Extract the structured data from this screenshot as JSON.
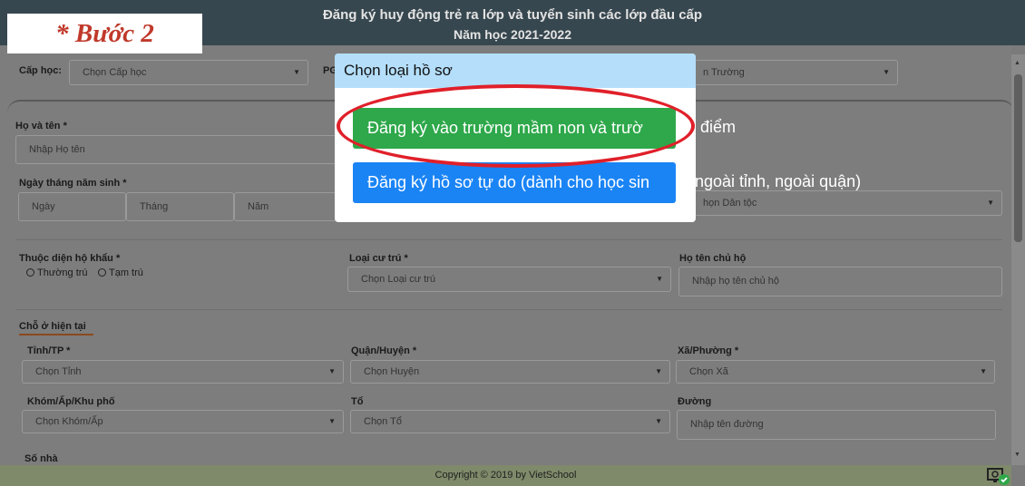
{
  "header": {
    "line1": "Đăng ký huy động trẻ ra lớp và tuyển sinh các lớp đầu cấp",
    "line2": "Năm học 2021-2022",
    "step_tag": "* Bước 2"
  },
  "filters": {
    "cap_hoc_label": "Cấp học:",
    "cap_hoc_value": "Chọn Cấp học",
    "second_label_fragment": "PG",
    "school_value_fragment": "n Trường"
  },
  "form": {
    "ho_ten_label": "Họ và tên *",
    "ho_ten_placeholder": "Nhập Họ tên",
    "dob_label": "Ngày tháng năm sinh *",
    "dob_day": "Ngày",
    "dob_month": "Tháng",
    "dob_year": "Năm",
    "dan_toc_fragment": "họn Dân tộc",
    "ho_khau_label": "Thuộc diện hộ khẩu *",
    "ho_khau_opt1": "Thường trú",
    "ho_khau_opt2": "Tạm trú",
    "loai_cu_tru_label": "Loại cư trú *",
    "loai_cu_tru_value": "Chọn Loại cư trú",
    "chu_ho_label": "Họ tên chủ hộ",
    "chu_ho_placeholder": "Nhập họ tên chủ hộ",
    "current_section": "Chỗ ở hiện tại",
    "tinh_label": "Tỉnh/TP *",
    "tinh_value": "Chọn Tỉnh",
    "huyen_label": "Quận/Huyện *",
    "huyen_value": "Chọn Huyện",
    "xa_label": "Xã/Phường *",
    "xa_value": "Chọn Xã",
    "khom_label": "Khóm/Ấp/Khu phố",
    "khom_value": "Chọn Khóm/Ấp",
    "to_label": "Tổ",
    "to_value": "Chọn Tổ",
    "duong_label": "Đường",
    "duong_placeholder": "Nhập tên đường",
    "so_nha_label": "Số nhà"
  },
  "modal": {
    "title": "Chọn loại hồ sơ",
    "btn_green_visible": "Đăng ký vào trường mầm non và trườ",
    "btn_green_overflow": "điểm",
    "btn_blue_visible": "Đăng ký hồ sơ tự do (dành cho học sin",
    "btn_blue_overflow": "ngoài tỉnh, ngoài quận)"
  },
  "footer": {
    "copyright": "Copyright © 2019 by VietSchool"
  },
  "colors": {
    "header_bg": "#37474f",
    "overlay": "#7d7d7d",
    "modal_header": "#b4defa",
    "green_button": "#2ea84a",
    "blue_button": "#1a84f5",
    "highlight_ring": "#e0202a",
    "step_text": "#c0392b"
  },
  "icons": {
    "tray": "monitor-check-icon",
    "dropdown": "caret-down-icon"
  }
}
